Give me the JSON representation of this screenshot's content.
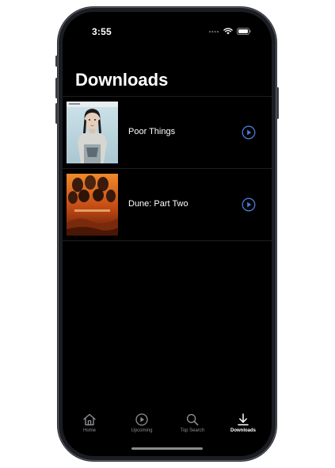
{
  "status_bar": {
    "time": "3:55"
  },
  "page": {
    "title": "Downloads"
  },
  "downloads": [
    {
      "title": "Poor Things",
      "poster_icon": "poster-poor-things"
    },
    {
      "title": "Dune: Part Two",
      "poster_icon": "poster-dune-part-two"
    }
  ],
  "tab_bar": {
    "tabs": [
      {
        "label": "Home",
        "icon": "house-icon",
        "active": false
      },
      {
        "label": "Upcoming",
        "icon": "play-circle-icon",
        "active": false
      },
      {
        "label": "Top Search",
        "icon": "magnifier-icon",
        "active": false
      },
      {
        "label": "Downloads",
        "icon": "download-icon",
        "active": true
      }
    ]
  },
  "colors": {
    "accent": "#4a7bd8",
    "background": "#000000",
    "inactive_tab": "#8e8e93",
    "active_tab": "#ffffff"
  }
}
